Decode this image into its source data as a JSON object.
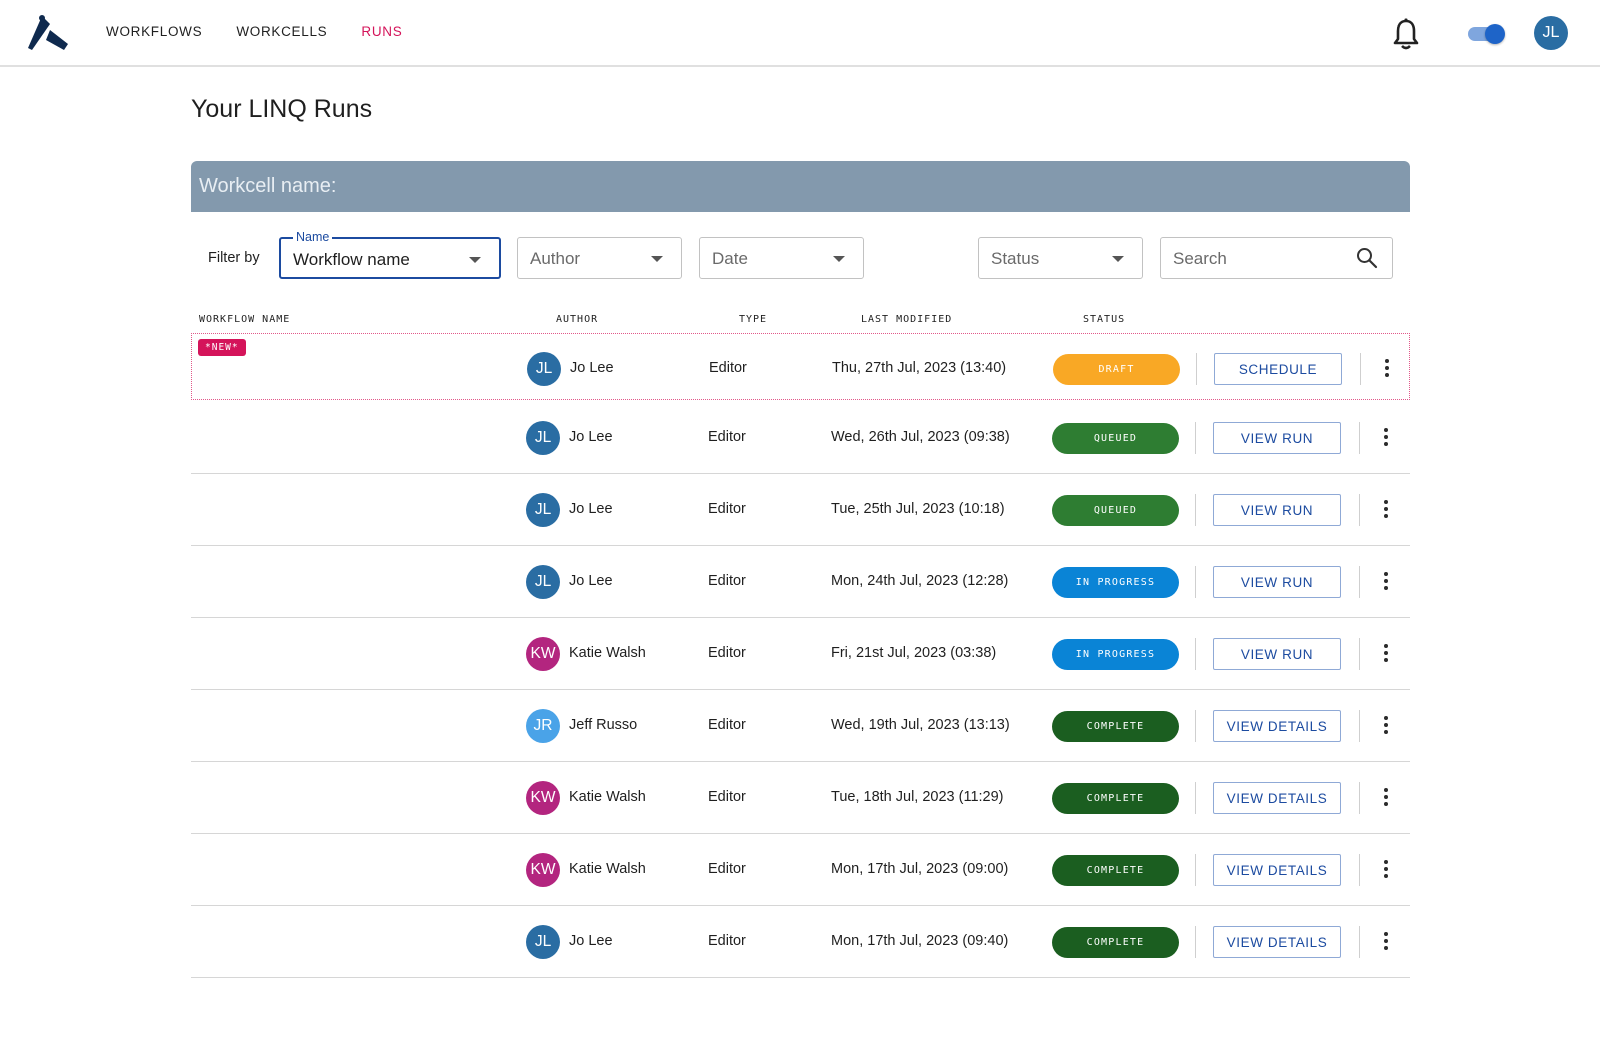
{
  "nav": {
    "items": [
      {
        "label": "WORKFLOWS",
        "active": false
      },
      {
        "label": "WORKCELLS",
        "active": false
      },
      {
        "label": "RUNS",
        "active": true
      }
    ],
    "user_initials": "JL",
    "toggle_on": true,
    "icons": {
      "logo": "brand-logo",
      "notifications": "bell-icon"
    }
  },
  "page": {
    "title": "Your LINQ Runs",
    "workcell_label": "Workcell name:"
  },
  "filters": {
    "label": "Filter by",
    "name": {
      "float_label": "Name",
      "value": "Workflow name"
    },
    "author": {
      "placeholder": "Author"
    },
    "date": {
      "placeholder": "Date"
    },
    "status": {
      "placeholder": "Status"
    },
    "search": {
      "placeholder": "Search"
    }
  },
  "table": {
    "headers": {
      "workflow_name": "WORKFLOW NAME",
      "author": "AUTHOR",
      "type": "TYPE",
      "last_modified": "LAST MODIFIED",
      "status": "STATUS"
    },
    "rows": [
      {
        "badge": "*NEW*",
        "initials": "JL",
        "author": "Jo Lee",
        "type": "Editor",
        "modified": "Thu, 27th Jul, 2023 (13:40)",
        "status": "DRAFT",
        "action": "SCHEDULE"
      },
      {
        "initials": "JL",
        "author": "Jo Lee",
        "type": "Editor",
        "modified": "Wed, 26th Jul, 2023 (09:38)",
        "status": "QUEUED",
        "action": "VIEW RUN"
      },
      {
        "initials": "JL",
        "author": "Jo Lee",
        "type": "Editor",
        "modified": "Tue, 25th Jul, 2023 (10:18)",
        "status": "QUEUED",
        "action": "VIEW RUN"
      },
      {
        "initials": "JL",
        "author": "Jo Lee",
        "type": "Editor",
        "modified": "Mon, 24th Jul, 2023 (12:28)",
        "status": "IN PROGRESS",
        "action": "VIEW RUN"
      },
      {
        "initials": "KW",
        "author": "Katie Walsh",
        "type": "Editor",
        "modified": "Fri, 21st Jul, 2023 (03:38)",
        "status": "IN PROGRESS",
        "action": "VIEW RUN"
      },
      {
        "initials": "JR",
        "author": "Jeff Russo",
        "type": "Editor",
        "modified": "Wed, 19th Jul, 2023 (13:13)",
        "status": "COMPLETE",
        "action": "VIEW DETAILS"
      },
      {
        "initials": "KW",
        "author": "Katie Walsh",
        "type": "Editor",
        "modified": "Tue, 18th Jul, 2023 (11:29)",
        "status": "COMPLETE",
        "action": "VIEW DETAILS"
      },
      {
        "initials": "KW",
        "author": "Katie Walsh",
        "type": "Editor",
        "modified": "Mon, 17th Jul, 2023 (09:00)",
        "status": "COMPLETE",
        "action": "VIEW DETAILS"
      },
      {
        "initials": "JL",
        "author": "Jo Lee",
        "type": "Editor",
        "modified": "Mon, 17th Jul, 2023 (09:40)",
        "status": "COMPLETE",
        "action": "VIEW DETAILS"
      }
    ]
  },
  "colors": {
    "accent": "#d4145a",
    "primary": "#1c4ba0",
    "status": {
      "DRAFT": "#f9a825",
      "QUEUED": "#2e7d32",
      "IN PROGRESS": "#0a84d6",
      "COMPLETE": "#1b5e20"
    },
    "avatars": {
      "JL": "#2a6da3",
      "KW": "#b3257f",
      "JR": "#4aa3e8"
    }
  }
}
